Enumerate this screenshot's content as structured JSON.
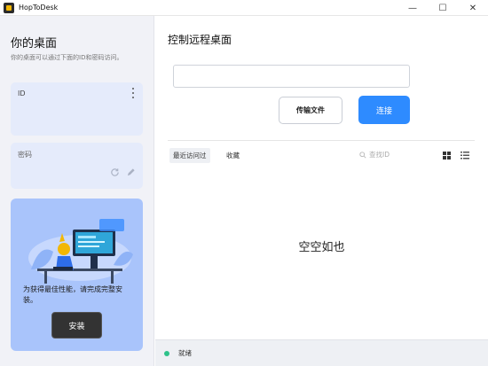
{
  "window": {
    "title": "HopToDesk",
    "controls": [
      "—",
      "☐",
      "✕"
    ]
  },
  "left": {
    "title": "你的桌面",
    "description": "你的桌面可以通过下面的ID和密码访问。",
    "id_label": "ID",
    "password_label": "密码",
    "promo_text": "为获得最佳性能，请完成完整安装。",
    "install_label": "安装"
  },
  "right": {
    "title": "控制远程桌面",
    "id_input_value": "",
    "transfer_label": "传输文件",
    "connect_label": "连接",
    "tabs": [
      "最近访问过",
      "收藏"
    ],
    "search_placeholder": "查找ID",
    "empty_text": "空空如也"
  },
  "status": {
    "text": "就绪",
    "color": "#2ec28a"
  },
  "colors": {
    "accent": "#2e8bff",
    "promo_bg": "#a9c4fb",
    "card_bg": "#e5ebfb"
  },
  "icons": {
    "app_logo": "hoptodesk-logo-icon",
    "more": "more-vertical-icon",
    "refresh": "refresh-icon",
    "edit": "pencil-icon",
    "search": "search-icon",
    "grid": "grid-view-icon",
    "list": "list-view-icon"
  }
}
